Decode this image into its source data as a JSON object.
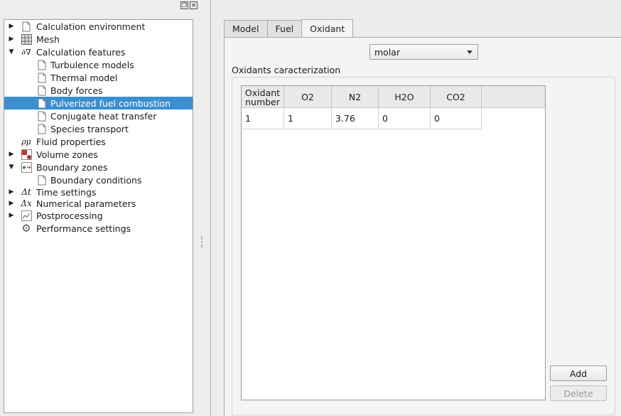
{
  "tree": {
    "items": [
      {
        "label": "Calculation environment",
        "icon": "document-icon",
        "expander": "collapsed"
      },
      {
        "label": "Mesh",
        "icon": "mesh-grid-icon",
        "expander": "collapsed"
      },
      {
        "label": "Calculation features",
        "icon": "equation-icon",
        "expander": "expanded"
      },
      {
        "label": "Turbulence models",
        "icon": "document-icon",
        "expander": "none"
      },
      {
        "label": "Thermal model",
        "icon": "document-icon",
        "expander": "none"
      },
      {
        "label": "Body forces",
        "icon": "document-icon",
        "expander": "none"
      },
      {
        "label": "Pulverized fuel combustion",
        "icon": "document-icon",
        "expander": "none",
        "selected": true
      },
      {
        "label": "Conjugate heat transfer",
        "icon": "document-icon",
        "expander": "none"
      },
      {
        "label": "Species transport",
        "icon": "document-icon",
        "expander": "none"
      },
      {
        "label": "Fluid properties",
        "icon": "rho-mu-icon",
        "expander": "none"
      },
      {
        "label": "Volume zones",
        "icon": "volume-zones-icon",
        "expander": "collapsed"
      },
      {
        "label": "Boundary zones",
        "icon": "boundary-zones-icon",
        "expander": "expanded"
      },
      {
        "label": "Boundary conditions",
        "icon": "document-icon",
        "expander": "none"
      },
      {
        "label": "Time settings",
        "icon": "delta-t-icon",
        "expander": "collapsed"
      },
      {
        "label": "Numerical parameters",
        "icon": "delta-x-icon",
        "expander": "collapsed"
      },
      {
        "label": "Postprocessing",
        "icon": "chart-icon",
        "expander": "collapsed"
      },
      {
        "label": "Performance settings",
        "icon": "gear-icon",
        "expander": "none"
      }
    ]
  },
  "tabs": [
    {
      "label": "Model",
      "active": false
    },
    {
      "label": "Fuel",
      "active": false
    },
    {
      "label": "Oxidant",
      "active": true
    }
  ],
  "unit_combo": {
    "value": "molar"
  },
  "oxidants": {
    "group_title": "Oxidants caracterization",
    "columns": [
      "Oxidant\nnumber",
      "O2",
      "N2",
      "H2O",
      "CO2"
    ],
    "rows": [
      [
        "1",
        "1",
        "3.76",
        "0",
        "0"
      ]
    ]
  },
  "buttons": {
    "add_label": "Add",
    "delete_label": "Delete"
  },
  "colors": {
    "selection": "#3a8fd0"
  }
}
